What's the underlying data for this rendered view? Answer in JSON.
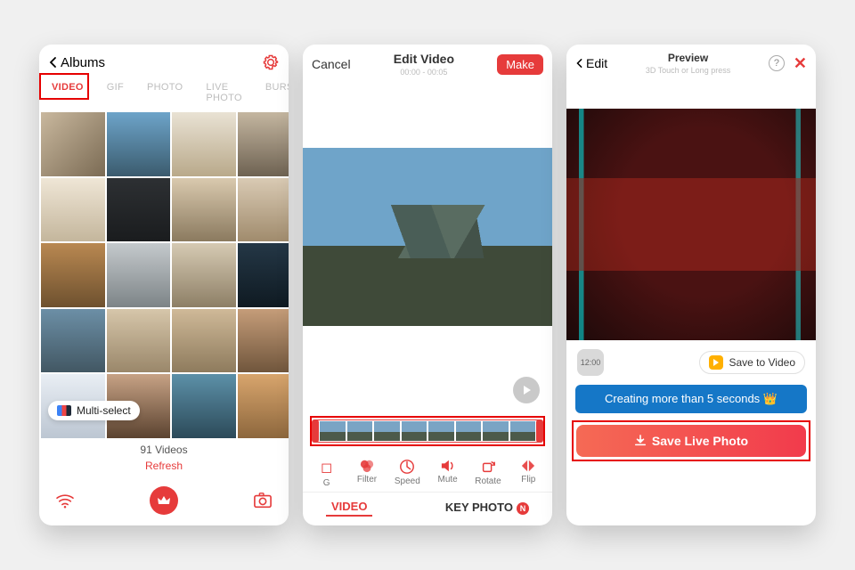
{
  "screen1": {
    "back_label": "Albums",
    "tabs": [
      "VIDEO",
      "GIF",
      "PHOTO",
      "LIVE PHOTO",
      "BURST"
    ],
    "active_tab_index": 0,
    "multiselect_label": "Multi-select",
    "count_label": "91 Videos",
    "refresh_label": "Refresh"
  },
  "screen2": {
    "cancel_label": "Cancel",
    "title": "Edit Video",
    "time_range": "00:00 - 00:05",
    "make_label": "Make",
    "tools": [
      {
        "label": "G"
      },
      {
        "label": "Filter"
      },
      {
        "label": "Speed"
      },
      {
        "label": "Mute"
      },
      {
        "label": "Rotate"
      },
      {
        "label": "Flip"
      }
    ],
    "bottom_video": "VIDEO",
    "bottom_key": "KEY PHOTO",
    "new_badge": "N"
  },
  "screen3": {
    "back_label": "Edit",
    "title": "Preview",
    "subtitle": "3D Touch or Long press",
    "duration_badge": "12:00",
    "save_video_label": "Save to Video",
    "info_text": "Creating more than 5 seconds 👑",
    "save_button_label": "Save Live Photo"
  }
}
